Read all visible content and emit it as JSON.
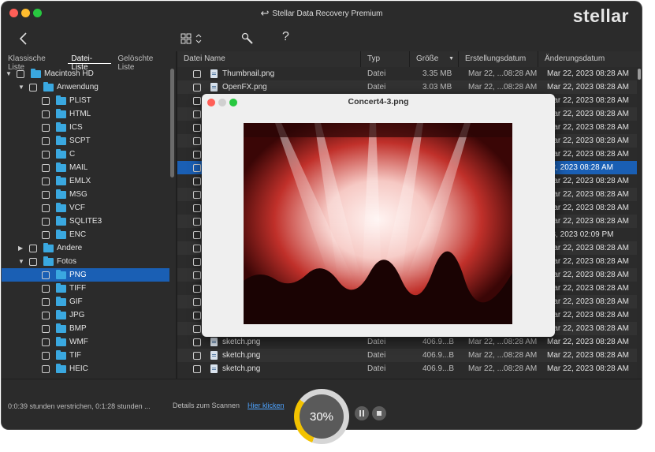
{
  "window": {
    "title": "Stellar Data Recovery Premium",
    "brand": "stellar"
  },
  "toolbar": {
    "back_icon": "chevron-left-icon",
    "view_icon": "grid-view-icon",
    "tools_icon": "wrench-icon",
    "help_label": "?"
  },
  "left_tabs": [
    "Klassische Liste",
    "Datei-Liste",
    "Gelöschte Liste"
  ],
  "tree": [
    {
      "label": "Macintosh HD",
      "level": 0,
      "arrow": "▼",
      "selected": false
    },
    {
      "label": "Anwendung",
      "level": 1,
      "arrow": "▼",
      "selected": false
    },
    {
      "label": "PLIST",
      "level": 2,
      "arrow": "",
      "selected": false
    },
    {
      "label": "HTML",
      "level": 2,
      "arrow": "",
      "selected": false
    },
    {
      "label": "ICS",
      "level": 2,
      "arrow": "",
      "selected": false
    },
    {
      "label": "SCPT",
      "level": 2,
      "arrow": "",
      "selected": false
    },
    {
      "label": "C",
      "level": 2,
      "arrow": "",
      "selected": false
    },
    {
      "label": "MAIL",
      "level": 2,
      "arrow": "",
      "selected": false
    },
    {
      "label": "EMLX",
      "level": 2,
      "arrow": "",
      "selected": false
    },
    {
      "label": "MSG",
      "level": 2,
      "arrow": "",
      "selected": false
    },
    {
      "label": "VCF",
      "level": 2,
      "arrow": "",
      "selected": false
    },
    {
      "label": "SQLITE3",
      "level": 2,
      "arrow": "",
      "selected": false
    },
    {
      "label": "ENC",
      "level": 2,
      "arrow": "",
      "selected": false
    },
    {
      "label": "Andere",
      "level": 1,
      "arrow": "▶",
      "selected": false
    },
    {
      "label": "Fotos",
      "level": 1,
      "arrow": "▼",
      "selected": false
    },
    {
      "label": "PNG",
      "level": 2,
      "arrow": "",
      "selected": true
    },
    {
      "label": "TIFF",
      "level": 2,
      "arrow": "",
      "selected": false
    },
    {
      "label": "GIF",
      "level": 2,
      "arrow": "",
      "selected": false
    },
    {
      "label": "JPG",
      "level": 2,
      "arrow": "",
      "selected": false
    },
    {
      "label": "BMP",
      "level": 2,
      "arrow": "",
      "selected": false
    },
    {
      "label": "WMF",
      "level": 2,
      "arrow": "",
      "selected": false
    },
    {
      "label": "TIF",
      "level": 2,
      "arrow": "",
      "selected": false
    },
    {
      "label": "HEIC",
      "level": 2,
      "arrow": "",
      "selected": false
    }
  ],
  "columns": [
    "Datei Name",
    "Typ",
    "Größe",
    "Erstellungsdatum",
    "Änderungsdatum"
  ],
  "rows": [
    {
      "name": "Thumbnail.png",
      "type": "Datei",
      "size": "3.35 MB",
      "created": "Mar 22, ...08:28 AM",
      "modified": "Mar 22, 2023 08:28 AM",
      "selected": false
    },
    {
      "name": "OpenFX.png",
      "type": "Datei",
      "size": "3.03 MB",
      "created": "Mar 22, ...08:28 AM",
      "modified": "Mar 22, 2023 08:28 AM",
      "selected": false
    },
    {
      "name": "",
      "type": "",
      "size": "",
      "created": "",
      "modified": "Mar 22, 2023 08:28 AM",
      "selected": false
    },
    {
      "name": "",
      "type": "",
      "size": "",
      "created": "",
      "modified": "Mar 22, 2023 08:28 AM",
      "selected": false
    },
    {
      "name": "",
      "type": "",
      "size": "",
      "created": "",
      "modified": "Mar 22, 2023 08:28 AM",
      "selected": false
    },
    {
      "name": "",
      "type": "",
      "size": "",
      "created": "",
      "modified": "Mar 22, 2023 08:28 AM",
      "selected": false
    },
    {
      "name": "",
      "type": "",
      "size": "",
      "created": "",
      "modified": "Mar 22, 2023 08:28 AM",
      "selected": false
    },
    {
      "name": "",
      "type": "",
      "size": "",
      "created": "",
      "modified": "22, 2023 08:28 AM",
      "selected": true
    },
    {
      "name": "",
      "type": "",
      "size": "",
      "created": "",
      "modified": "Mar 22, 2023 08:28 AM",
      "selected": false
    },
    {
      "name": "",
      "type": "",
      "size": "",
      "created": "",
      "modified": "Mar 22, 2023 08:28 AM",
      "selected": false
    },
    {
      "name": "",
      "type": "",
      "size": "",
      "created": "",
      "modified": "Mar 22, 2023 08:28 AM",
      "selected": false
    },
    {
      "name": "",
      "type": "",
      "size": "",
      "created": "",
      "modified": "Mar 22, 2023 08:28 AM",
      "selected": false
    },
    {
      "name": "",
      "type": "",
      "size": "",
      "created": "",
      "modified": "08, 2023 02:09 PM",
      "selected": false
    },
    {
      "name": "",
      "type": "",
      "size": "",
      "created": "",
      "modified": "Mar 22, 2023 08:28 AM",
      "selected": false
    },
    {
      "name": "",
      "type": "",
      "size": "",
      "created": "",
      "modified": "Mar 22, 2023 08:28 AM",
      "selected": false
    },
    {
      "name": "",
      "type": "",
      "size": "",
      "created": "",
      "modified": "Mar 22, 2023 08:28 AM",
      "selected": false
    },
    {
      "name": "",
      "type": "",
      "size": "",
      "created": "",
      "modified": "Mar 22, 2023 08:28 AM",
      "selected": false
    },
    {
      "name": "",
      "type": "",
      "size": "",
      "created": "",
      "modified": "Mar 22, 2023 08:28 AM",
      "selected": false
    },
    {
      "name": "",
      "type": "",
      "size": "",
      "created": "",
      "modified": "Mar 22, 2023 08:28 AM",
      "selected": false
    },
    {
      "name": "",
      "type": "",
      "size": "",
      "created": "",
      "modified": "Mar 22, 2023 08:28 AM",
      "selected": false
    },
    {
      "name": "sketch.png",
      "type": "Datei",
      "size": "406.9...B",
      "created": "Mar 22, ...08:28 AM",
      "modified": "Mar 22, 2023 08:28 AM",
      "selected": false
    },
    {
      "name": "sketch.png",
      "type": "Datei",
      "size": "406.9...B",
      "created": "Mar 22, ...08:28 AM",
      "modified": "Mar 22, 2023 08:28 AM",
      "selected": false
    },
    {
      "name": "sketch.png",
      "type": "Datei",
      "size": "406.9...B",
      "created": "Mar 22, ...08:28 AM",
      "modified": "Mar 22, 2023 08:28 AM",
      "selected": false
    }
  ],
  "preview": {
    "title": "Concert4-3.png"
  },
  "status": {
    "elapsed": "0:0:39 stunden verstrichen, 0:1:28 stunden ...",
    "details_label": "Details zum Scannen",
    "details_link": "Hier klicken",
    "progress_text": "30%",
    "progress": 0.3
  },
  "colors": {
    "accent": "#1a5fb4",
    "progress": "#f2c200",
    "folder": "#3aa8e0",
    "link": "#4ea3ff"
  }
}
